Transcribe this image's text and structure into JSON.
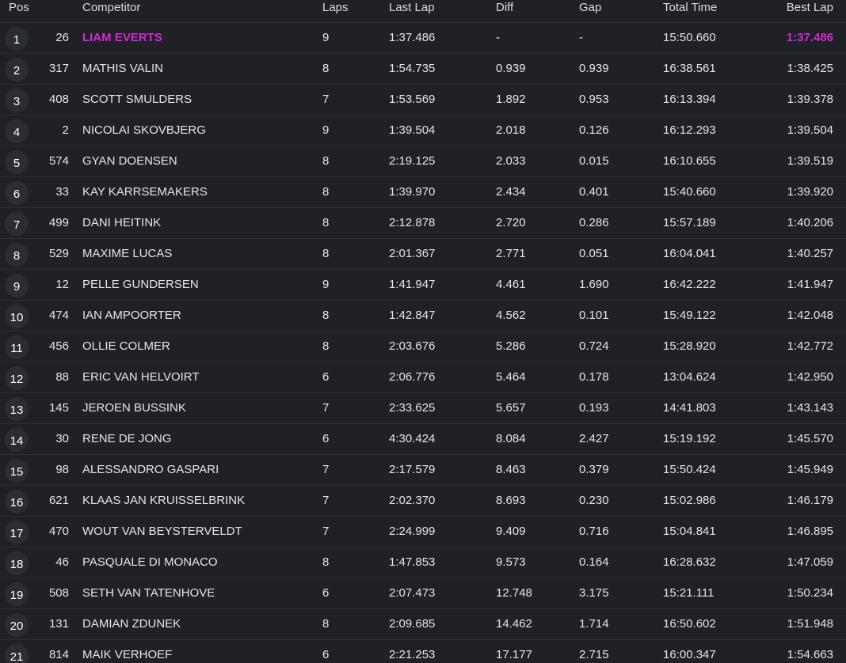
{
  "header": {
    "pos": "Pos",
    "competitor": "Competitor",
    "laps": "Laps",
    "last_lap": "Last Lap",
    "diff": "Diff",
    "gap": "Gap",
    "total_time": "Total Time",
    "best_lap": "Best Lap"
  },
  "colors": {
    "background": "#1f2127",
    "leader_highlight": "#d22ad2",
    "badge": "#2a2d34"
  },
  "rows": [
    {
      "pos": "1",
      "num": "26",
      "name": "LIAM EVERTS",
      "laps": "9",
      "last": "1:37.486",
      "diff": "-",
      "gap": "-",
      "total": "15:50.660",
      "best": "1:37.486",
      "leader": true
    },
    {
      "pos": "2",
      "num": "317",
      "name": "MATHIS VALIN",
      "laps": "8",
      "last": "1:54.735",
      "diff": "0.939",
      "gap": "0.939",
      "total": "16:38.561",
      "best": "1:38.425"
    },
    {
      "pos": "3",
      "num": "408",
      "name": "SCOTT SMULDERS",
      "laps": "7",
      "last": "1:53.569",
      "diff": "1.892",
      "gap": "0.953",
      "total": "16:13.394",
      "best": "1:39.378"
    },
    {
      "pos": "4",
      "num": "2",
      "name": "NICOLAI SKOVBJERG",
      "laps": "9",
      "last": "1:39.504",
      "diff": "2.018",
      "gap": "0.126",
      "total": "16:12.293",
      "best": "1:39.504"
    },
    {
      "pos": "5",
      "num": "574",
      "name": "GYAN DOENSEN",
      "laps": "8",
      "last": "2:19.125",
      "diff": "2.033",
      "gap": "0.015",
      "total": "16:10.655",
      "best": "1:39.519"
    },
    {
      "pos": "6",
      "num": "33",
      "name": "KAY KARRSEMAKERS",
      "laps": "8",
      "last": "1:39.970",
      "diff": "2.434",
      "gap": "0.401",
      "total": "15:40.660",
      "best": "1:39.920"
    },
    {
      "pos": "7",
      "num": "499",
      "name": "DANI HEITINK",
      "laps": "8",
      "last": "2:12.878",
      "diff": "2.720",
      "gap": "0.286",
      "total": "15:57.189",
      "best": "1:40.206"
    },
    {
      "pos": "8",
      "num": "529",
      "name": "MAXIME LUCAS",
      "laps": "8",
      "last": "2:01.367",
      "diff": "2.771",
      "gap": "0.051",
      "total": "16:04.041",
      "best": "1:40.257"
    },
    {
      "pos": "9",
      "num": "12",
      "name": "PELLE GUNDERSEN",
      "laps": "9",
      "last": "1:41.947",
      "diff": "4.461",
      "gap": "1.690",
      "total": "16:42.222",
      "best": "1:41.947"
    },
    {
      "pos": "10",
      "num": "474",
      "name": "IAN AMPOORTER",
      "laps": "8",
      "last": "1:42.847",
      "diff": "4.562",
      "gap": "0.101",
      "total": "15:49.122",
      "best": "1:42.048"
    },
    {
      "pos": "11",
      "num": "456",
      "name": "OLLIE COLMER",
      "laps": "8",
      "last": "2:03.676",
      "diff": "5.286",
      "gap": "0.724",
      "total": "15:28.920",
      "best": "1:42.772"
    },
    {
      "pos": "12",
      "num": "88",
      "name": "ERIC VAN HELVOIRT",
      "laps": "6",
      "last": "2:06.776",
      "diff": "5.464",
      "gap": "0.178",
      "total": "13:04.624",
      "best": "1:42.950"
    },
    {
      "pos": "13",
      "num": "145",
      "name": "JEROEN BUSSINK",
      "laps": "7",
      "last": "2:33.625",
      "diff": "5.657",
      "gap": "0.193",
      "total": "14:41.803",
      "best": "1:43.143"
    },
    {
      "pos": "14",
      "num": "30",
      "name": "RENE DE JONG",
      "laps": "6",
      "last": "4:30.424",
      "diff": "8.084",
      "gap": "2.427",
      "total": "15:19.192",
      "best": "1:45.570"
    },
    {
      "pos": "15",
      "num": "98",
      "name": "ALESSANDRO GASPARI",
      "laps": "7",
      "last": "2:17.579",
      "diff": "8.463",
      "gap": "0.379",
      "total": "15:50.424",
      "best": "1:45.949"
    },
    {
      "pos": "16",
      "num": "621",
      "name": "KLAAS JAN KRUISSELBRINK",
      "laps": "7",
      "last": "2:02.370",
      "diff": "8.693",
      "gap": "0.230",
      "total": "15:02.986",
      "best": "1:46.179"
    },
    {
      "pos": "17",
      "num": "470",
      "name": "WOUT VAN BEYSTERVELDT",
      "laps": "7",
      "last": "2:24.999",
      "diff": "9.409",
      "gap": "0.716",
      "total": "15:04.841",
      "best": "1:46.895"
    },
    {
      "pos": "18",
      "num": "46",
      "name": "PASQUALE DI MONACO",
      "laps": "8",
      "last": "1:47.853",
      "diff": "9.573",
      "gap": "0.164",
      "total": "16:28.632",
      "best": "1:47.059"
    },
    {
      "pos": "19",
      "num": "508",
      "name": "SETH VAN TATENHOVE",
      "laps": "6",
      "last": "2:07.473",
      "diff": "12.748",
      "gap": "3.175",
      "total": "15:21.111",
      "best": "1:50.234"
    },
    {
      "pos": "20",
      "num": "131",
      "name": "DAMIAN ZDUNEK",
      "laps": "8",
      "last": "2:09.685",
      "diff": "14.462",
      "gap": "1.714",
      "total": "16:50.602",
      "best": "1:51.948"
    },
    {
      "pos": "21",
      "num": "814",
      "name": "MAIK VERHOEF",
      "laps": "6",
      "last": "2:21.253",
      "diff": "17.177",
      "gap": "2.715",
      "total": "16:00.347",
      "best": "1:54.663"
    }
  ]
}
